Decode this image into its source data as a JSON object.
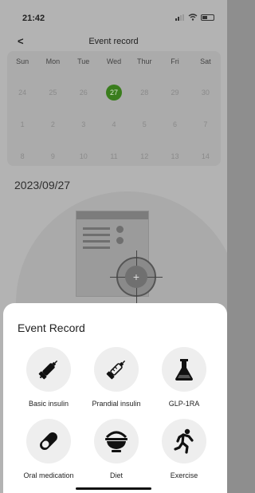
{
  "status": {
    "time": "21:42"
  },
  "nav": {
    "back_icon": "chevron-left-icon",
    "title": "Event record"
  },
  "calendar": {
    "weekdays": [
      "Sun",
      "Mon",
      "Tue",
      "Wed",
      "Thur",
      "Fri",
      "Sat"
    ],
    "weeks": [
      [
        "24",
        "25",
        "26",
        "27",
        "28",
        "29",
        "30"
      ],
      [
        "1",
        "2",
        "3",
        "4",
        "5",
        "6",
        "7"
      ],
      [
        "8",
        "9",
        "10",
        "11",
        "12",
        "13",
        "14"
      ]
    ],
    "selected": "27",
    "selected_color": "#3a7d1d"
  },
  "date_label": "2023/09/27",
  "sheet": {
    "title": "Event Record",
    "options": [
      {
        "label": "Basic insulin",
        "icon": "syringe-icon"
      },
      {
        "label": "Prandial insulin",
        "icon": "syringe-outline-icon"
      },
      {
        "label": "GLP-1RA",
        "icon": "flask-icon"
      },
      {
        "label": "Oral medication",
        "icon": "pill-icon"
      },
      {
        "label": "Diet",
        "icon": "bowl-icon"
      },
      {
        "label": "Exercise",
        "icon": "running-icon"
      }
    ]
  }
}
